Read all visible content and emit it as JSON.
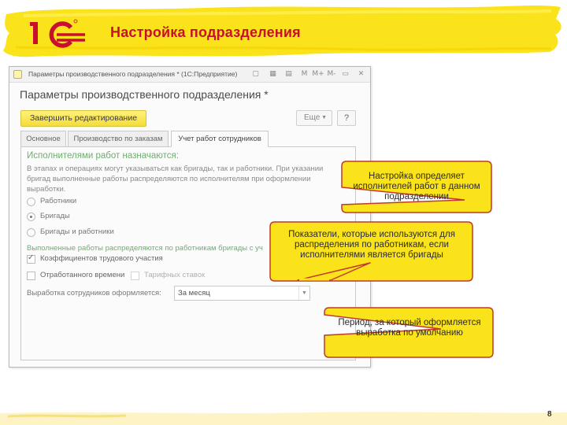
{
  "slide": {
    "title": "Настройка подразделения",
    "page_number": "8",
    "brand_color": "#c8102e",
    "accent_yellow": "#fbe31c"
  },
  "window": {
    "title": "Параметры производственного подразделения * (1С:Предприятие)",
    "toolbar_icons": [
      "favorites-icon",
      "calendar-icon",
      "history-icon",
      "M",
      "M+",
      "M-",
      "minimize-icon",
      "close-icon"
    ]
  },
  "form": {
    "title": "Параметры производственного подразделения *",
    "finish_editing_button": "Завершить редактирование",
    "more_button": "Еще",
    "help_button": "?",
    "tabs": [
      {
        "label": "Основное"
      },
      {
        "label": "Производство по заказам"
      },
      {
        "label": "Учет работ сотрудников"
      }
    ],
    "active_tab": "Учет работ сотрудников",
    "executors_section": {
      "title": "Исполнителями работ назначаются:",
      "hint": "В этапах и операциях могут указываться как бригады, так и работники. При указании бригад выполненные работы распределяются по исполнителям при оформлении выработки.",
      "options": [
        {
          "label": "Работники",
          "selected": false
        },
        {
          "label": "Бригады",
          "selected": true
        },
        {
          "label": "Бригады и работники",
          "selected": false
        }
      ]
    },
    "distribution_section": {
      "title": "Выполненные работы распределяются по работникам бригады с уч",
      "checkboxes": [
        {
          "label": "Коэффициентов трудового участия",
          "checked": true,
          "enabled": true
        },
        {
          "label": "Отработанного времени",
          "checked": false,
          "enabled": true
        },
        {
          "label": "Тарифных ставок",
          "checked": false,
          "enabled": false
        }
      ]
    },
    "output_period": {
      "label": "Выработка сотрудников оформляется:",
      "value": "За месяц"
    }
  },
  "callouts": [
    {
      "text": "Настройка определяет исполнителей работ в данном подразделении"
    },
    {
      "text": "Показатели, которые используются для распределения по работникам, если исполнителями является бригады"
    },
    {
      "text": "Период, за который оформляется выработка по умолчанию"
    }
  ]
}
